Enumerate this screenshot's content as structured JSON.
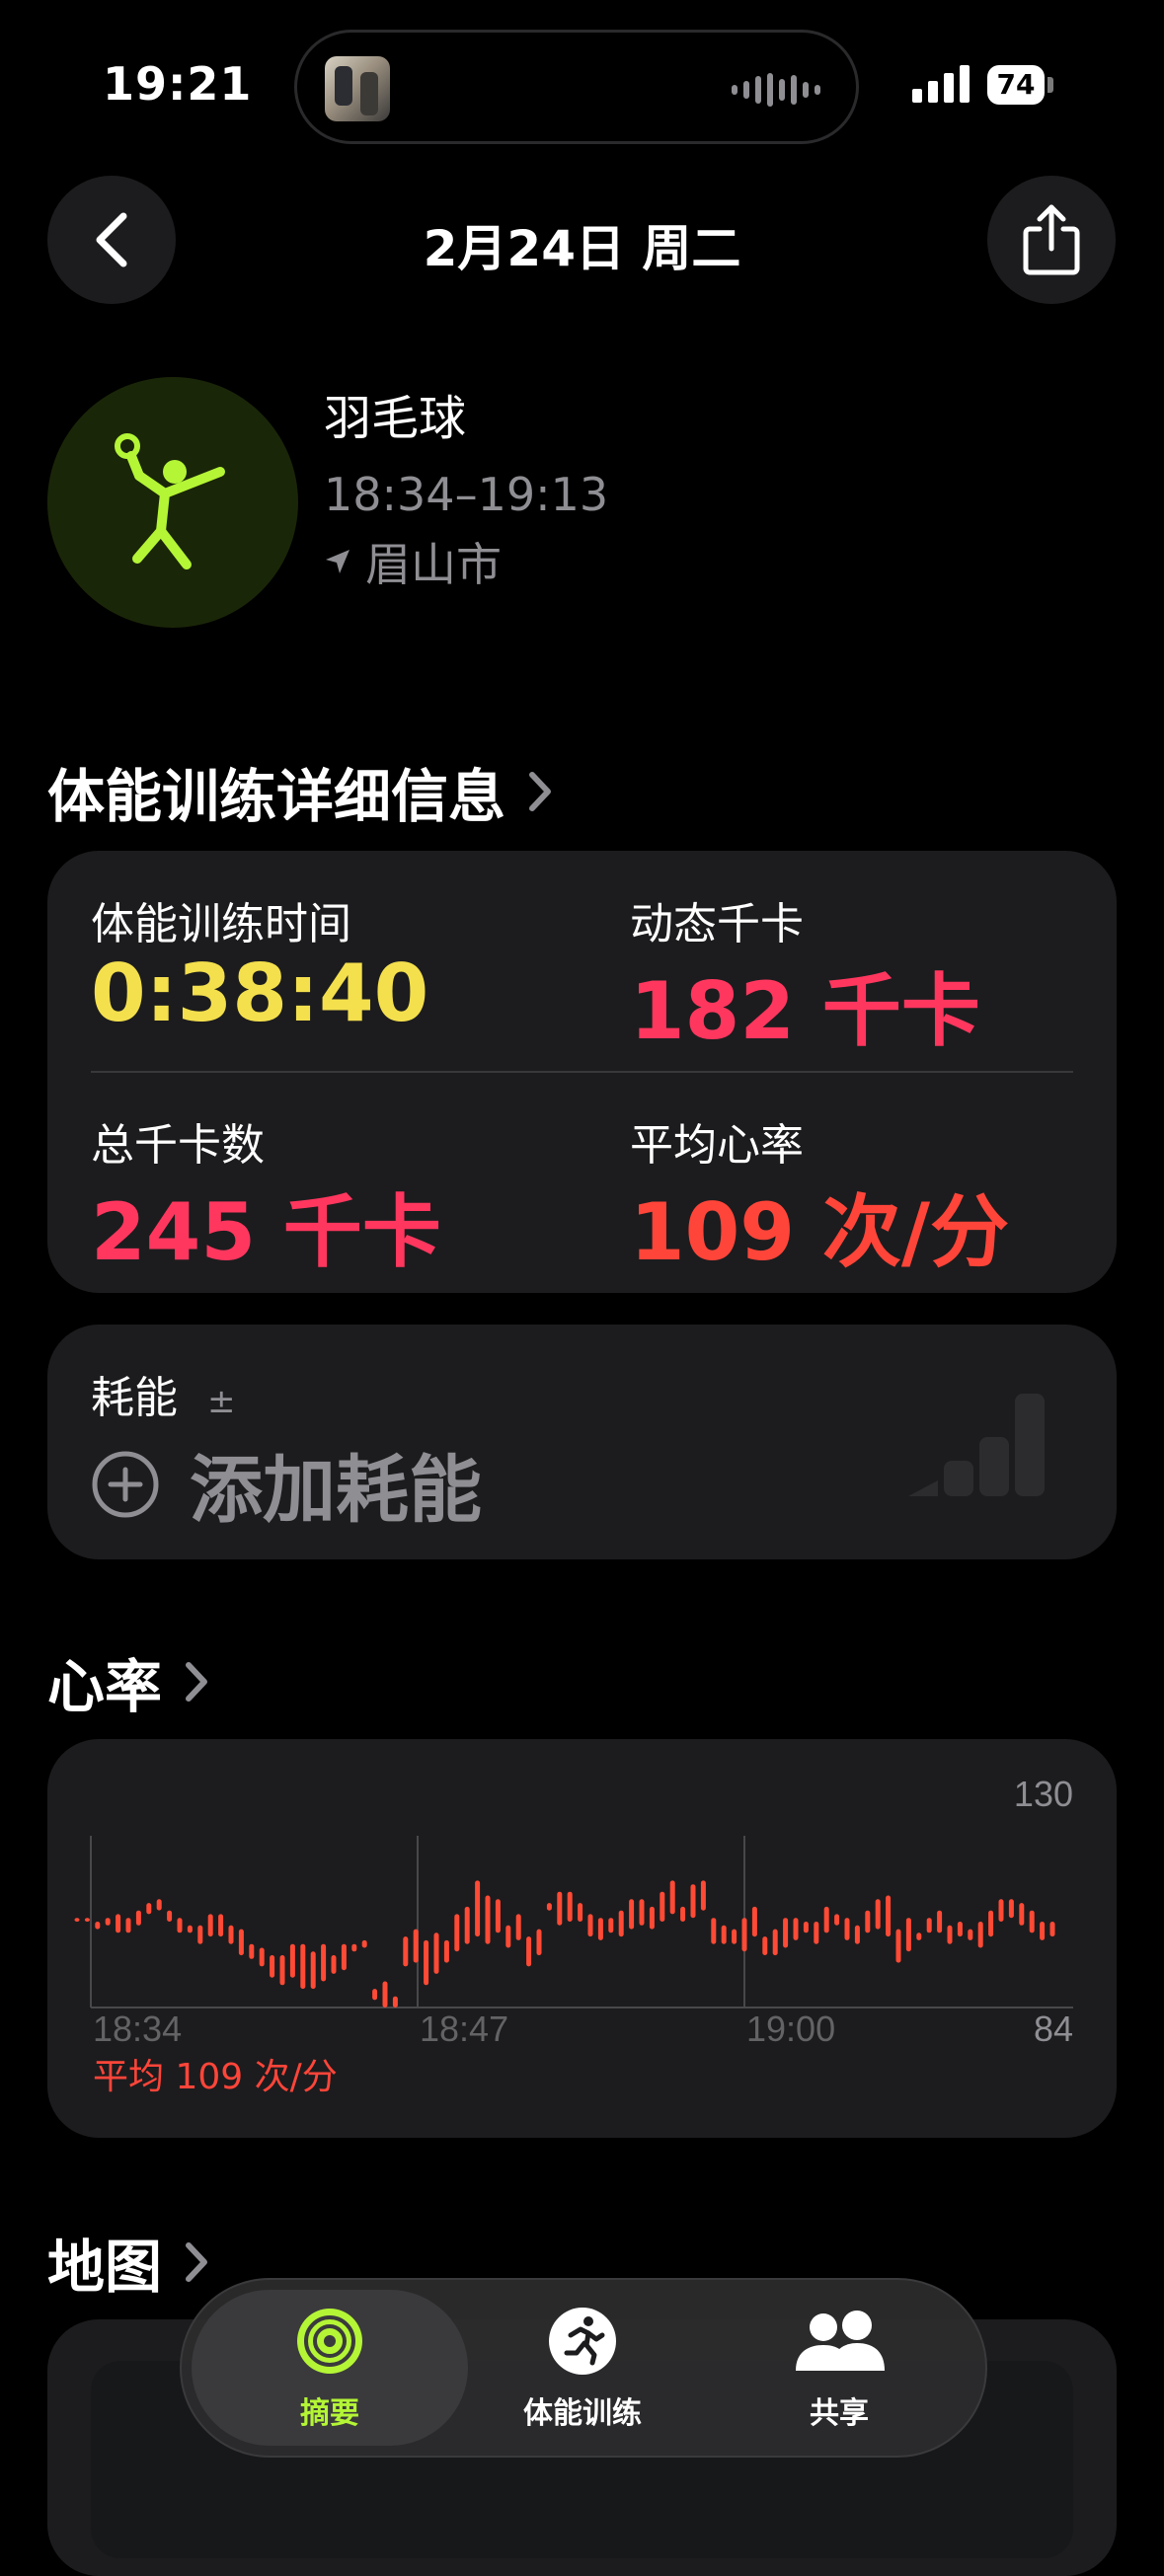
{
  "status_bar": {
    "time": "19:21",
    "battery": "74"
  },
  "header": {
    "date": "2月24日 周二",
    "back_icon": "chevron-left-icon",
    "share_icon": "share-icon"
  },
  "workout": {
    "icon": "badminton-icon",
    "title": "羽毛球",
    "time_range": "18:34–19:13",
    "location": "眉山市"
  },
  "details_section": {
    "title": "体能训练详细信息"
  },
  "metrics": {
    "duration_label": "体能训练时间",
    "duration_value": "0:38:40",
    "active_cal_label": "动态千卡",
    "active_cal_value": "182 千卡",
    "total_cal_label": "总千卡数",
    "total_cal_value": "245 千卡",
    "avg_hr_label": "平均心率",
    "avg_hr_value": "109 次/分"
  },
  "effort": {
    "label": "耗能",
    "label_suffix": "±",
    "add_label": "添加耗能"
  },
  "heart_rate": {
    "title": "心率",
    "avg_label": "平均 109 次/分"
  },
  "chart_data": {
    "type": "bar",
    "title": "",
    "x_ticks": [
      "18:34",
      "18:47",
      "19:00"
    ],
    "ymax_label": "130",
    "ymin_label": "84",
    "ylim": [
      84,
      130
    ],
    "color": "#ff4a36",
    "ranges": [
      [
        107,
        108
      ],
      [
        107,
        108
      ],
      [
        105,
        107
      ],
      [
        106,
        108
      ],
      [
        104,
        109
      ],
      [
        104,
        108
      ],
      [
        106,
        110
      ],
      [
        109,
        112
      ],
      [
        110,
        113
      ],
      [
        107,
        110
      ],
      [
        104,
        108
      ],
      [
        104,
        106
      ],
      [
        101,
        106
      ],
      [
        103,
        109
      ],
      [
        103,
        109
      ],
      [
        101,
        106
      ],
      [
        98,
        105
      ],
      [
        97,
        101
      ],
      [
        95,
        100
      ],
      [
        92,
        98
      ],
      [
        90,
        98
      ],
      [
        92,
        101
      ],
      [
        89,
        101
      ],
      [
        89,
        99
      ],
      [
        91,
        101
      ],
      [
        93,
        98
      ],
      [
        94,
        101
      ],
      [
        99,
        101
      ],
      [
        100,
        102
      ],
      [
        86,
        89
      ],
      [
        84,
        91
      ],
      [
        84,
        87
      ],
      [
        95,
        103
      ],
      [
        96,
        105
      ],
      [
        90,
        102
      ],
      [
        93,
        104
      ],
      [
        96,
        102
      ],
      [
        99,
        109
      ],
      [
        101,
        111
      ],
      [
        103,
        118
      ],
      [
        101,
        114
      ],
      [
        104,
        113
      ],
      [
        100,
        106
      ],
      [
        102,
        109
      ],
      [
        95,
        103
      ],
      [
        98,
        105
      ],
      [
        110,
        112
      ],
      [
        106,
        115
      ],
      [
        107,
        115
      ],
      [
        107,
        112
      ],
      [
        103,
        109
      ],
      [
        102,
        108
      ],
      [
        104,
        108
      ],
      [
        103,
        110
      ],
      [
        105,
        113
      ],
      [
        106,
        113
      ],
      [
        105,
        111
      ],
      [
        107,
        115
      ],
      [
        109,
        118
      ],
      [
        107,
        111
      ],
      [
        108,
        117
      ],
      [
        110,
        118
      ],
      [
        101,
        108
      ],
      [
        101,
        106
      ],
      [
        101,
        105
      ],
      [
        99,
        108
      ],
      [
        103,
        111
      ],
      [
        98,
        103
      ],
      [
        98,
        105
      ],
      [
        100,
        108
      ],
      [
        102,
        108
      ],
      [
        104,
        107
      ],
      [
        101,
        107
      ],
      [
        104,
        111
      ],
      [
        106,
        109
      ],
      [
        102,
        108
      ],
      [
        101,
        106
      ],
      [
        104,
        110
      ],
      [
        105,
        113
      ],
      [
        103,
        114
      ],
      [
        96,
        105
      ],
      [
        99,
        108
      ],
      [
        102,
        104
      ],
      [
        104,
        108
      ],
      [
        104,
        110
      ],
      [
        101,
        106
      ],
      [
        103,
        107
      ],
      [
        102,
        105
      ],
      [
        100,
        107
      ],
      [
        103,
        110
      ],
      [
        107,
        113
      ],
      [
        108,
        113
      ],
      [
        106,
        112
      ],
      [
        104,
        110
      ],
      [
        102,
        107
      ],
      [
        103,
        107
      ]
    ]
  },
  "map_section": {
    "title": "地图"
  },
  "tab_bar": {
    "tabs": [
      {
        "label": "摘要",
        "icon": "activity-rings-icon"
      },
      {
        "label": "体能训练",
        "icon": "running-figure-icon"
      },
      {
        "label": "共享",
        "icon": "people-icon"
      }
    ]
  },
  "colors": {
    "accent_green": "#b4f536",
    "duration_yellow": "#f4e04d",
    "calories_pink": "#ff375f",
    "heart_red": "#ff4539",
    "card_bg": "#1c1c1e"
  }
}
